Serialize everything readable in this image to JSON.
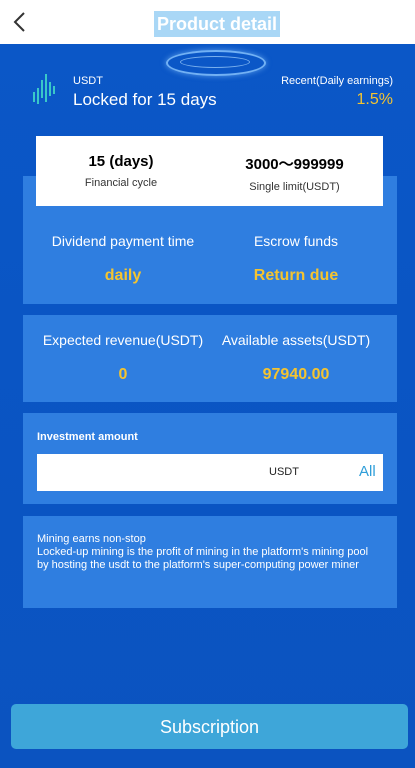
{
  "header": {
    "title": "Product detail",
    "back_icon": "chevron-left-icon"
  },
  "product": {
    "coin": "USDT",
    "locked_text": "Locked for 15 days",
    "recent_label": "Recent(Daily earnings)",
    "rate": "1.5%",
    "icon": "chart-bars-icon"
  },
  "summary": {
    "cycle_value": "15 (days)",
    "cycle_label": "Financial cycle",
    "limit_value": "3000～999999",
    "limit_label": "Single limit(USDT)"
  },
  "dividend": {
    "label_left": "Dividend payment time",
    "value_left": "daily",
    "label_right": "Escrow funds",
    "value_right": "Return due"
  },
  "revenue": {
    "label_left": "Expected revenue(USDT)",
    "value_left": "0",
    "label_right": "Available assets(USDT)",
    "value_right": "97940.00"
  },
  "investment": {
    "label": "Investment amount",
    "value": "",
    "unit": "USDT",
    "all_label": "All"
  },
  "description": {
    "line1": "Mining earns non-stop",
    "line2": "Locked-up mining is the profit of mining in the platform's mining pool by hosting the usdt to the platform's super-computing power miner"
  },
  "footer": {
    "subscribe_label": "Subscription"
  },
  "colors": {
    "background": "#0a55c4",
    "panel": "#2f7ee0",
    "accent_gold": "#f4c430",
    "button": "#3ea6d9"
  }
}
